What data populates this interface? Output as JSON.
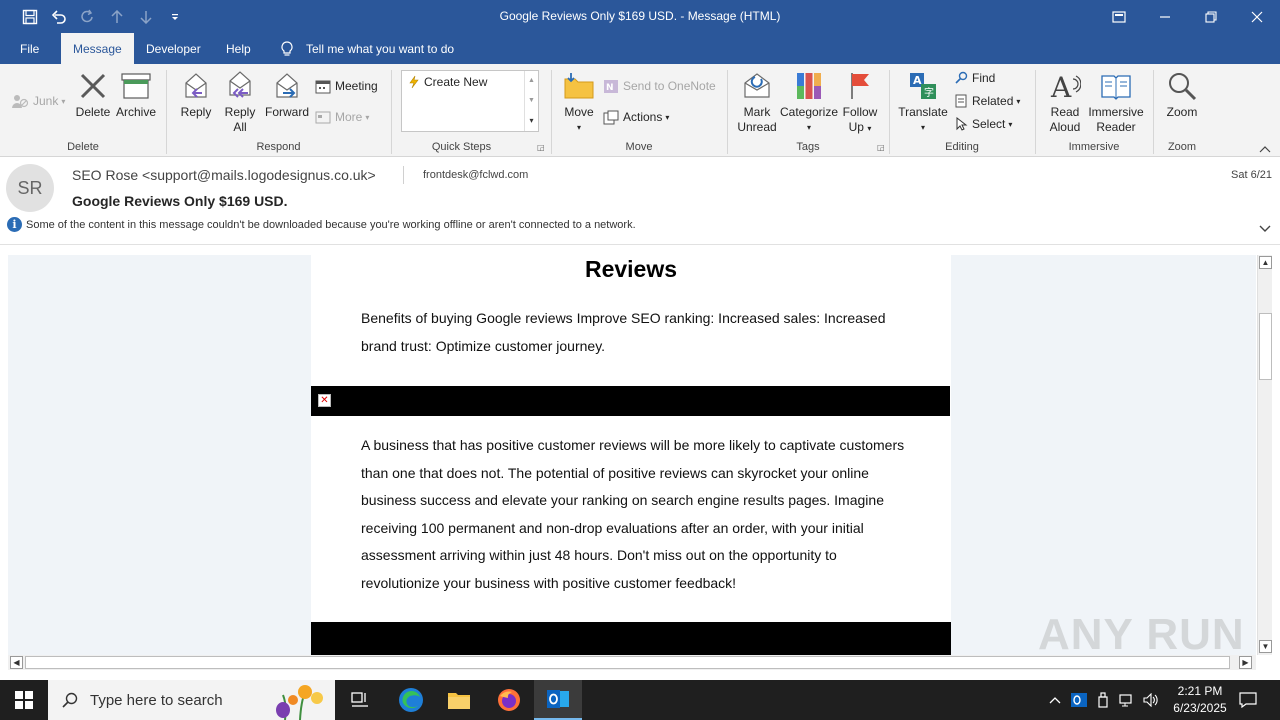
{
  "window": {
    "title": "Google Reviews Only $169 USD.  -  Message (HTML)"
  },
  "tabs": [
    {
      "label": "File"
    },
    {
      "label": "Message"
    },
    {
      "label": "Developer"
    },
    {
      "label": "Help"
    }
  ],
  "tell_me": "Tell me what you want to do",
  "ribbon": {
    "delete_group": {
      "label": "Delete",
      "junk": "Junk",
      "delete": "Delete",
      "archive": "Archive"
    },
    "respond_group": {
      "label": "Respond",
      "reply": "Reply",
      "reply_all_1": "Reply",
      "reply_all_2": "All",
      "forward": "Forward",
      "meeting": "Meeting",
      "more": "More"
    },
    "quicksteps_group": {
      "label": "Quick Steps",
      "create_new": "Create New"
    },
    "move_group": {
      "label": "Move",
      "move": "Move",
      "onenote": "Send to OneNote",
      "actions": "Actions"
    },
    "tags_group": {
      "label": "Tags",
      "mark_unread_1": "Mark",
      "mark_unread_2": "Unread",
      "categorize": "Categorize",
      "follow_up_1": "Follow",
      "follow_up_2": "Up"
    },
    "editing_group": {
      "label": "Editing",
      "translate": "Translate",
      "find": "Find",
      "related": "Related",
      "select": "Select"
    },
    "immersive_group": {
      "label": "Immersive",
      "read_aloud_1": "Read",
      "read_aloud_2": "Aloud",
      "immersive_reader_1": "Immersive",
      "immersive_reader_2": "Reader"
    },
    "zoom_group": {
      "label": "Zoom",
      "zoom": "Zoom"
    }
  },
  "message": {
    "avatar_initials": "SR",
    "from": "SEO Rose <support@mails.logodesignus.co.uk>",
    "to": "frontdesk@fclwd.com",
    "date": "Sat 6/21",
    "subject": "Google Reviews Only $169 USD.",
    "info_bar": "Some of the content in this message couldn't be downloaded because you're working offline or aren't connected to a network."
  },
  "email_body": {
    "heading": "Reviews",
    "para1": "Benefits of buying Google reviews Improve SEO ranking: Increased sales: Increased brand trust: Optimize customer journey.",
    "para2": "A business that has positive customer reviews will be more likely to captivate customers than one that does not. The potential of positive reviews can skyrocket your online business success and elevate your ranking on search engine results pages. Imagine receiving 100 permanent and non-drop evaluations after an order, with your initial assessment arriving within just 48 hours. Don't miss out on the opportunity to revolutionize your business with positive customer feedback!"
  },
  "watermark": "ANY RUN",
  "taskbar": {
    "search_placeholder": "Type here to search",
    "time": "2:21 PM",
    "date": "6/23/2025"
  },
  "colors": {
    "office_blue": "#2b579a",
    "ribbon_bg": "#f3f3f3",
    "info_icon": "#2b6cb5",
    "taskbar": "#1f1f1f"
  }
}
